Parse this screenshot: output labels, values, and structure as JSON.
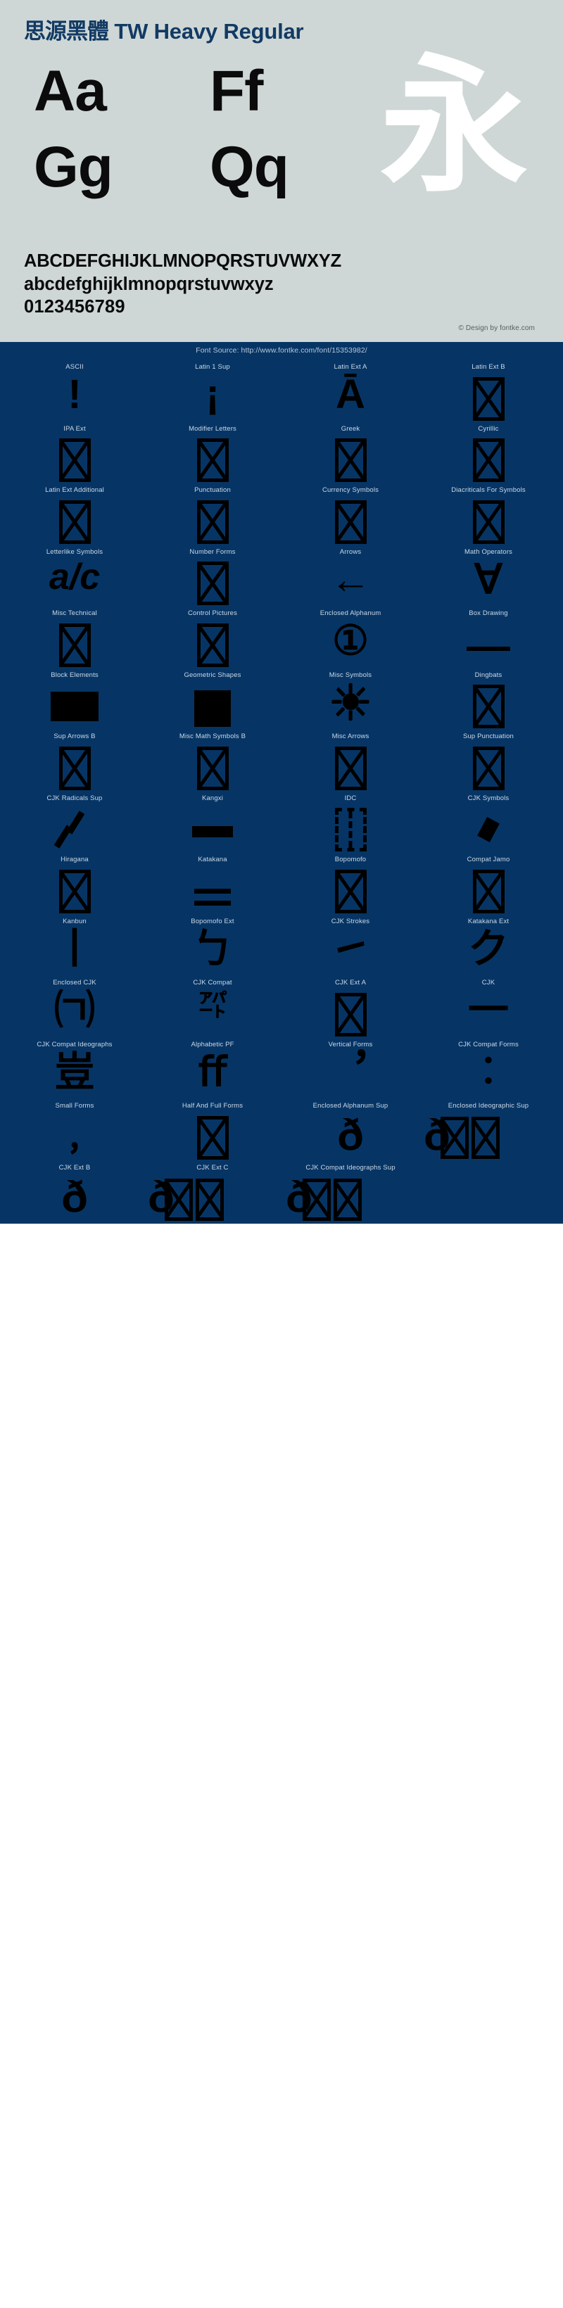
{
  "specimen": {
    "title_cjk": "思源黑體",
    "title_latin": " TW Heavy Regular",
    "showcase": {
      "aa": "Aa",
      "ff": "Ff",
      "gg": "Gg",
      "qq": "Qq",
      "cjk": "永"
    },
    "alphabet_upper": "ABCDEFGHIJKLMNOPQRSTUVWXYZ",
    "alphabet_lower": "abcdefghijklmnopqrstuvwxyz",
    "digits": "0123456789",
    "copyright": "© Design by fontke.com",
    "colors": {
      "panel_background": "#ced7d6",
      "title_color": "#123a63",
      "glyph_color": "#0b0b0b",
      "cjk_glyph_color": "#ffffff",
      "copyright_color": "#56605f"
    }
  },
  "blocks_panel": {
    "font_source": "Font Source: http://www.fontke.com/font/15353982/",
    "colors": {
      "background": "#063565",
      "label_color": "#ccd8e6",
      "sample_color": "#000000"
    },
    "cells": [
      {
        "label": "ASCII",
        "sample": "!",
        "kind": "glyph"
      },
      {
        "label": "Latin 1 Sup",
        "sample": "¡",
        "kind": "glyph"
      },
      {
        "label": "Latin Ext A",
        "sample": "Ā",
        "kind": "glyph"
      },
      {
        "label": "Latin Ext B",
        "sample": "",
        "kind": "tofu"
      },
      {
        "label": "IPA Ext",
        "sample": "",
        "kind": "tofu"
      },
      {
        "label": "Modifier Letters",
        "sample": "",
        "kind": "tofu"
      },
      {
        "label": "Greek",
        "sample": "",
        "kind": "tofu"
      },
      {
        "label": "Cyrillic",
        "sample": "",
        "kind": "tofu"
      },
      {
        "label": "Latin Ext Additional",
        "sample": "",
        "kind": "tofu"
      },
      {
        "label": "Punctuation",
        "sample": "",
        "kind": "tofu"
      },
      {
        "label": "Currency Symbols",
        "sample": "",
        "kind": "tofu"
      },
      {
        "label": "Diacriticals For Symbols",
        "sample": "",
        "kind": "tofu"
      },
      {
        "label": "Letterlike Symbols",
        "sample": "a/c",
        "kind": "glyph-italic"
      },
      {
        "label": "Number Forms",
        "sample": "",
        "kind": "tofu"
      },
      {
        "label": "Arrows",
        "sample": "←",
        "kind": "glyph"
      },
      {
        "label": "Math Operators",
        "sample": "∀",
        "kind": "glyph"
      },
      {
        "label": "Misc Technical",
        "sample": "",
        "kind": "tofu"
      },
      {
        "label": "Control Pictures",
        "sample": "",
        "kind": "tofu"
      },
      {
        "label": "Enclosed Alphanum",
        "sample": "①",
        "kind": "glyph"
      },
      {
        "label": "Box Drawing",
        "sample": "",
        "kind": "hline"
      },
      {
        "label": "Block Elements",
        "sample": "",
        "kind": "solid-block"
      },
      {
        "label": "Geometric Shapes",
        "sample": "",
        "kind": "solid-square"
      },
      {
        "label": "Misc Symbols",
        "sample": "☀",
        "kind": "sun"
      },
      {
        "label": "Dingbats",
        "sample": "",
        "kind": "tofu"
      },
      {
        "label": "Sup Arrows B",
        "sample": "",
        "kind": "tofu"
      },
      {
        "label": "Misc Math Symbols B",
        "sample": "",
        "kind": "tofu"
      },
      {
        "label": "Misc Arrows",
        "sample": "",
        "kind": "tofu"
      },
      {
        "label": "Sup Punctuation",
        "sample": "",
        "kind": "tofu"
      },
      {
        "label": "CJK Radicals Sup",
        "sample": "",
        "kind": "slash-pair"
      },
      {
        "label": "Kangxi",
        "sample": "",
        "kind": "hline-thick"
      },
      {
        "label": "IDC",
        "sample": "",
        "kind": "tofu-dashed"
      },
      {
        "label": "CJK Symbols",
        "sample": "",
        "kind": "rhombus"
      },
      {
        "label": "Hiragana",
        "sample": "",
        "kind": "tofu"
      },
      {
        "label": "Katakana",
        "sample": "",
        "kind": "equals"
      },
      {
        "label": "Bopomofo",
        "sample": "",
        "kind": "tofu"
      },
      {
        "label": "Compat Jamo",
        "sample": "",
        "kind": "tofu"
      },
      {
        "label": "Kanbun",
        "sample": "丨",
        "kind": "glyph"
      },
      {
        "label": "Bopomofo Ext",
        "sample": "ㄅ",
        "kind": "glyph"
      },
      {
        "label": "CJK Strokes",
        "sample": "㇀",
        "kind": "glyph"
      },
      {
        "label": "Katakana Ext",
        "sample": "ク",
        "kind": "glyph"
      },
      {
        "label": "Enclosed CJK",
        "sample": "㈀",
        "kind": "glyph"
      },
      {
        "label": "CJK Compat",
        "sample": "㌀",
        "kind": "glyph-small"
      },
      {
        "label": "CJK Ext A",
        "sample": "",
        "kind": "tofu"
      },
      {
        "label": "CJK",
        "sample": "一",
        "kind": "glyph"
      },
      {
        "label": "CJK Compat Ideographs",
        "sample": "豈",
        "kind": "glyph"
      },
      {
        "label": "Alphabetic PF",
        "sample": "ﬀ",
        "kind": "glyph"
      },
      {
        "label": "Vertical Forms",
        "sample": "︐",
        "kind": "glyph"
      },
      {
        "label": "CJK Compat Forms",
        "sample": "︰",
        "kind": "glyph"
      },
      {
        "label": "Small Forms",
        "sample": "﹐",
        "kind": "glyph"
      },
      {
        "label": "Half And Full Forms",
        "sample": "",
        "kind": "tofu"
      },
      {
        "label": "Enclosed Alphanum Sup",
        "sample": "ð",
        "kind": "eth"
      },
      {
        "label": "Enclosed Ideographic Sup",
        "sample": "ð",
        "kind": "eth-tofu-multi"
      },
      {
        "label": "CJK Ext B",
        "sample": "ð",
        "kind": "eth"
      },
      {
        "label": "CJK Ext C",
        "sample": "ð",
        "kind": "eth-tofu-multi"
      },
      {
        "label": "CJK Compat Ideographs Sup",
        "sample": "ð",
        "kind": "eth-tofu-multi"
      }
    ]
  }
}
